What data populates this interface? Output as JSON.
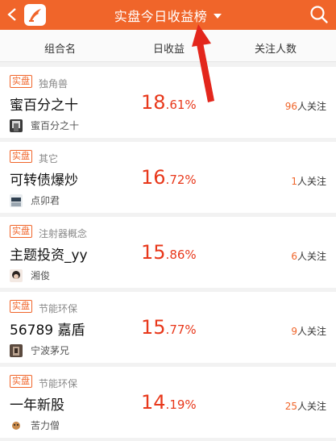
{
  "topbar": {
    "title": "实盘今日收益榜"
  },
  "columns": {
    "name": "组合名",
    "yield": "日收益",
    "followers": "关注人数"
  },
  "follow_suffix": "人关注",
  "rows": [
    {
      "badge": "实盘",
      "category": "独角兽",
      "name": "蜜百分之十",
      "owner": "蜜百分之十",
      "yield_int": "18",
      "yield_dec": ".61%",
      "followers": "96"
    },
    {
      "badge": "实盘",
      "category": "其它",
      "name": "可转债爆炒",
      "owner": "点卯君",
      "yield_int": "16",
      "yield_dec": ".72%",
      "followers": "1"
    },
    {
      "badge": "实盘",
      "category": "注射器概念",
      "name": "主题投资_yy",
      "owner": "湘俊",
      "yield_int": "15",
      "yield_dec": ".86%",
      "followers": "6"
    },
    {
      "badge": "实盘",
      "category": "节能环保",
      "name": "56789 嘉盾",
      "owner": "宁波茅兄",
      "yield_int": "15",
      "yield_dec": ".77%",
      "followers": "9"
    },
    {
      "badge": "实盘",
      "category": "节能环保",
      "name": "一年新股",
      "owner": "苦力僧",
      "yield_int": "14",
      "yield_dec": ".19%",
      "followers": "25"
    }
  ],
  "colors": {
    "brand": "#f0652a",
    "yield": "#e8381b",
    "arrow": "#e3261c"
  }
}
